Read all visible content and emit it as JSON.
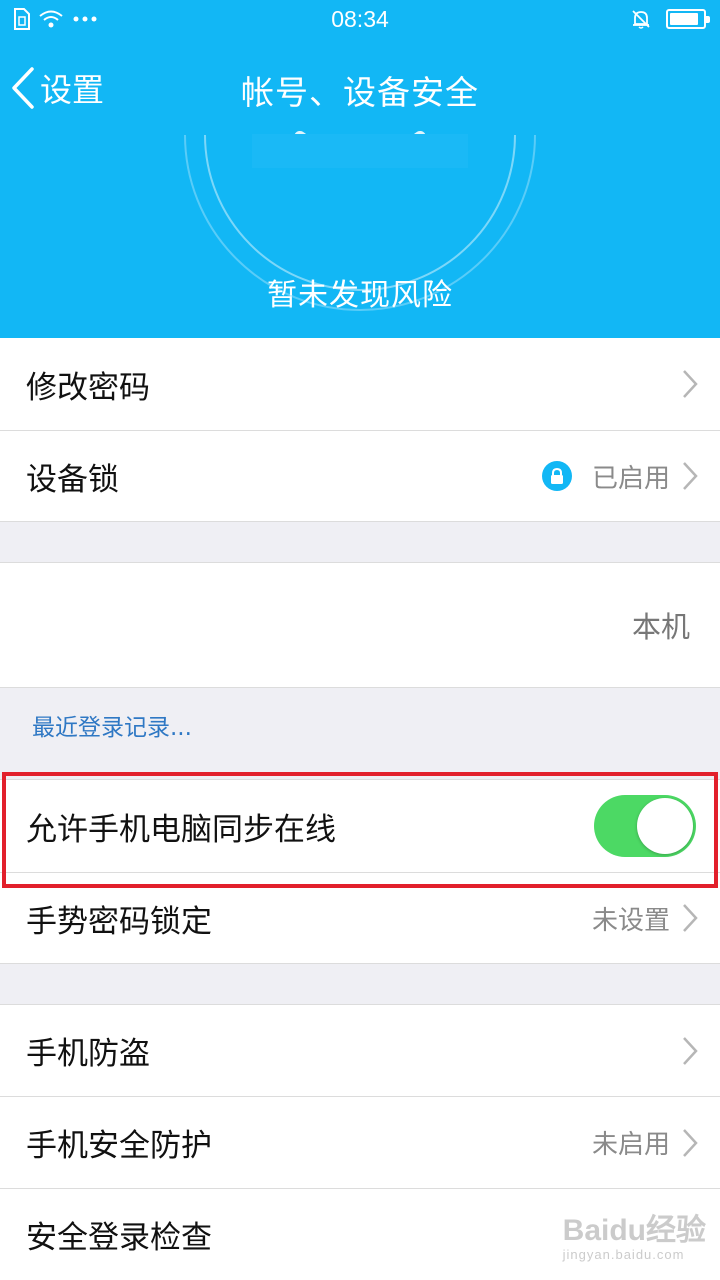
{
  "status_bar": {
    "time": "08:34"
  },
  "nav": {
    "back_label": "设置",
    "title": "帐号、设备安全"
  },
  "hero": {
    "status_text": "暂未发现风险"
  },
  "rows": {
    "change_password": {
      "label": "修改密码"
    },
    "device_lock": {
      "label": "设备锁",
      "value": "已启用"
    },
    "this_device": {
      "value": "本机"
    },
    "recent_login_link": "最近登录记录...",
    "sync_online": {
      "label": "允许手机电脑同步在线",
      "enabled": true
    },
    "gesture_lock": {
      "label": "手势密码锁定",
      "value": "未设置"
    },
    "anti_theft": {
      "label": "手机防盗"
    },
    "security_protection": {
      "label": "手机安全防护",
      "value": "未启用"
    },
    "secure_login_check": {
      "label": "安全登录检查"
    }
  },
  "watermark": {
    "brand": "Baidu经验",
    "url": "jingyan.baidu.com"
  },
  "colors": {
    "header_blue": "#12b7f5",
    "toggle_green": "#4cd964",
    "highlight_red": "#e2202b",
    "link_blue": "#2f78c4"
  },
  "battery_level_percent": 90
}
